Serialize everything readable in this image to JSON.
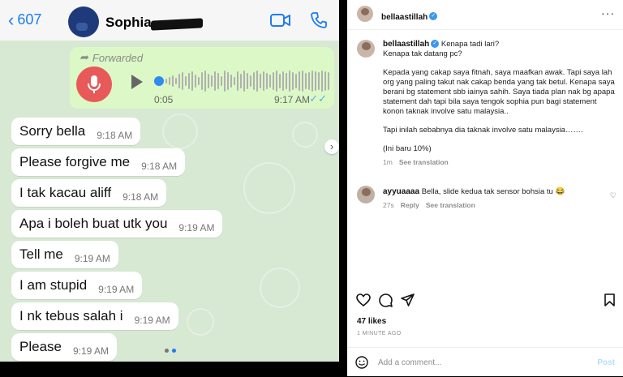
{
  "whatsapp": {
    "back_count": "607",
    "contact_name": "Sophia",
    "voice": {
      "forwarded_label": "Forwarded",
      "duration": "0:05",
      "time": "9:17 AM"
    },
    "messages": [
      {
        "text": "Sorry bella",
        "time": "9:18 AM"
      },
      {
        "text": "Please forgive me",
        "time": "9:18 AM"
      },
      {
        "text": "I tak kacau aliff",
        "time": "9:18 AM"
      },
      {
        "text": "Apa i boleh buat utk you",
        "time": "9:19 AM"
      },
      {
        "text": "Tell me",
        "time": "9:19 AM"
      },
      {
        "text": "I am stupid",
        "time": "9:19 AM"
      },
      {
        "text": "I nk tebus salah i",
        "time": "9:19 AM"
      },
      {
        "text": "Please",
        "time": "9:19 AM"
      }
    ]
  },
  "instagram": {
    "header_username": "bellaastillah",
    "caption": {
      "username": "bellaastillah",
      "line1": "Kenapa tadi lari?",
      "line2": "Kenapa tak datang pc?",
      "para1": "Kepada yang cakap saya fitnah, saya maafkan awak. Tapi saya lah org yang paling takut nak cakap benda yang tak betul. Kenapa saya berani bg statement sbb iainya sahih. Saya tiada plan nak bg apapa statement dah tapi bila saya tengok sophia pun bagi statement konon taknak involve satu malaysia..",
      "para2": "Tapi inilah sebabnya dia taknak involve satu malaysia…….",
      "para3": "(Ini baru 10%)",
      "time": "1m",
      "see_translation": "See translation"
    },
    "comment": {
      "username": "ayyuaaaa",
      "text": "Bella, slide kedua tak sensor bohsia tu 😂",
      "time": "27s",
      "reply": "Reply",
      "see_translation": "See translation"
    },
    "likes": "47 likes",
    "posted_ago": "1 MINUTE AGO",
    "add_comment_placeholder": "Add a comment...",
    "post_label": "Post"
  }
}
